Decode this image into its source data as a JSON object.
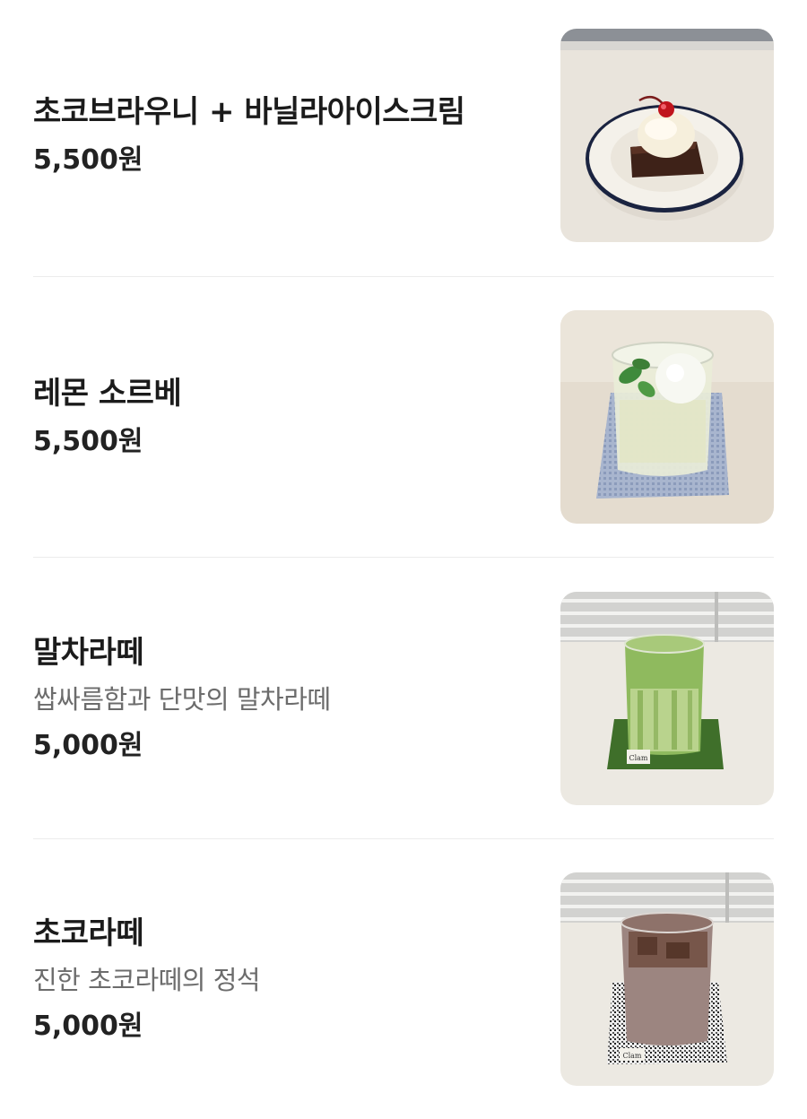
{
  "menu": {
    "items": [
      {
        "name": "초코브라우니 + 바닐라아이스크림",
        "description": "",
        "price": "5,500원",
        "image_icon": "brownie-icecream-photo"
      },
      {
        "name": "레몬 소르베",
        "description": "",
        "price": "5,500원",
        "image_icon": "lemon-sorbet-photo"
      },
      {
        "name": "말차라떼",
        "description": "쌉싸름함과 단맛의 말차라떼",
        "price": "5,000원",
        "image_icon": "matcha-latte-photo"
      },
      {
        "name": "초코라떼",
        "description": "진한 초코라떼의 정석",
        "price": "5,000원",
        "image_icon": "choco-latte-photo"
      }
    ],
    "coaster_labels": [
      "Clam",
      "Clam"
    ]
  }
}
